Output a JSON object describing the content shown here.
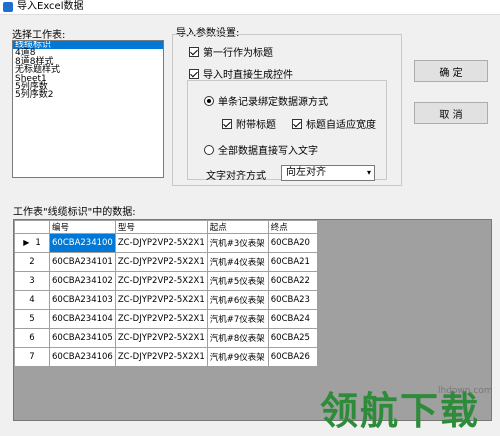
{
  "window": {
    "title": "导入Excel数据"
  },
  "sheets": {
    "label": "选择工作表:",
    "items": [
      "线缆标识",
      "4道8",
      "8道8样式",
      "无标题样式",
      "Sheet1",
      "5列序数",
      "5列序数2"
    ],
    "selected_index": 0
  },
  "import_settings": {
    "label": "导入参数设置:",
    "first_row_title": {
      "label": "第一行作为标题",
      "checked": true
    },
    "generate_controls": {
      "label": "导入时直接生成控件",
      "checked": true
    },
    "single_bind": {
      "label": "单条记录绑定数据源方式",
      "selected": true
    },
    "attach_title": {
      "label": "附带标题",
      "checked": true
    },
    "title_autowidth": {
      "label": "标题自适应宽度",
      "checked": true
    },
    "all_text": {
      "label": "全部数据直接写入文字",
      "selected": false
    },
    "text_align_label": "文字对齐方式",
    "text_align_value": "向左对齐"
  },
  "buttons": {
    "ok": "确 定",
    "cancel": "取 消"
  },
  "grid": {
    "caption": "工作表\"线缆标识\"中的数据:",
    "columns": [
      "编号",
      "型号",
      "起点",
      "终点"
    ],
    "row_indicator": "▶",
    "rows": [
      {
        "n": "1",
        "cells": [
          "60CBA234100",
          "ZC-DJYP2VP2-5X2X1",
          "汽机#3仪表架",
          "60CBA20"
        ]
      },
      {
        "n": "2",
        "cells": [
          "60CBA234101",
          "ZC-DJYP2VP2-5X2X1",
          "汽机#4仪表架",
          "60CBA21"
        ]
      },
      {
        "n": "3",
        "cells": [
          "60CBA234102",
          "ZC-DJYP2VP2-5X2X1",
          "汽机#5仪表架",
          "60CBA22"
        ]
      },
      {
        "n": "4",
        "cells": [
          "60CBA234103",
          "ZC-DJYP2VP2-5X2X1",
          "汽机#6仪表架",
          "60CBA23"
        ]
      },
      {
        "n": "5",
        "cells": [
          "60CBA234104",
          "ZC-DJYP2VP2-5X2X1",
          "汽机#7仪表架",
          "60CBA24"
        ]
      },
      {
        "n": "6",
        "cells": [
          "60CBA234105",
          "ZC-DJYP2VP2-5X2X1",
          "汽机#8仪表架",
          "60CBA25"
        ]
      },
      {
        "n": "7",
        "cells": [
          "60CBA234106",
          "ZC-DJYP2VP2-5X2X1",
          "汽机#9仪表架",
          "60CBA26"
        ]
      }
    ]
  },
  "watermark": {
    "text": "领航下载",
    "url": "lhdown.com"
  }
}
